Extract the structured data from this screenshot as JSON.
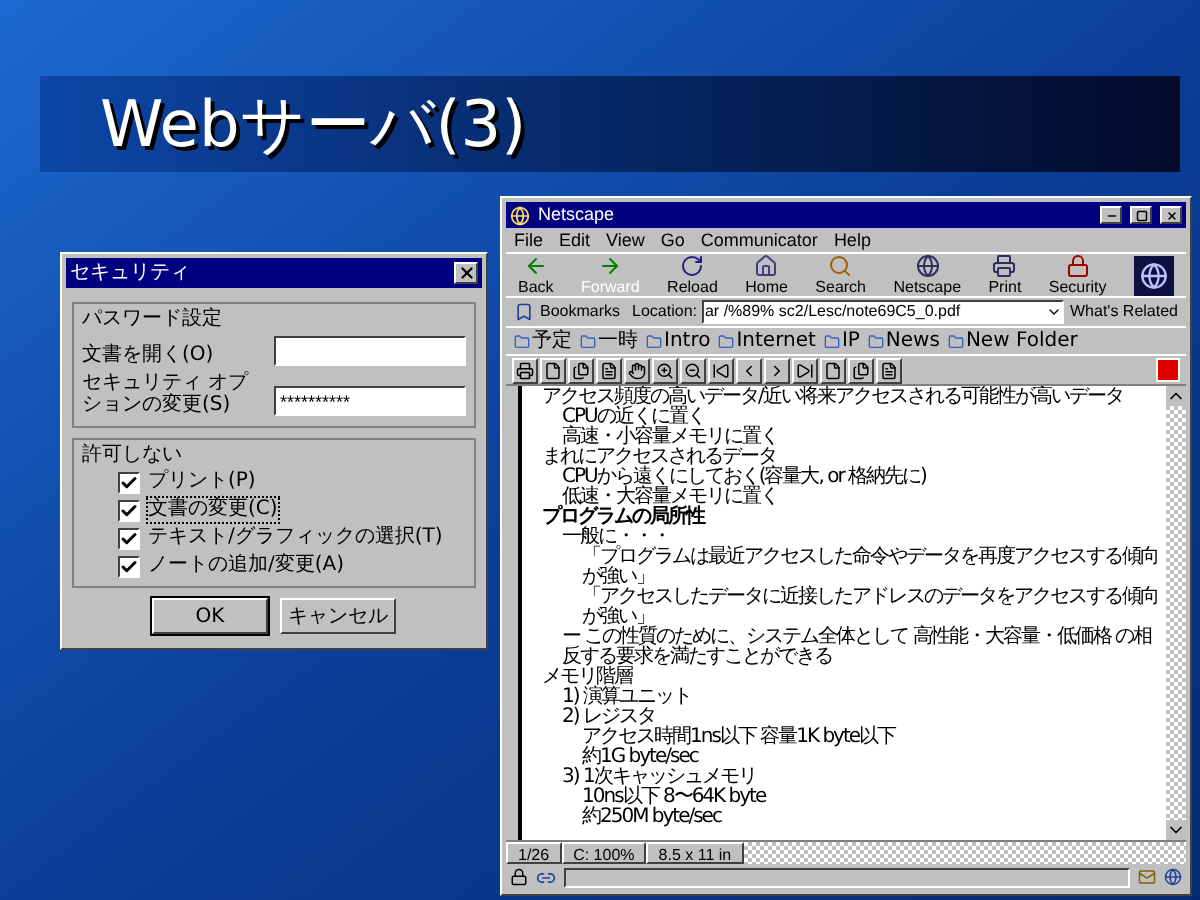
{
  "slide_title": "Webサーバ(3)",
  "dialog": {
    "title": "セキュリティ",
    "password_group": {
      "label": "パスワード設定",
      "fields": [
        {
          "label": "文書を開く(O)"
        },
        {
          "label": "セキュリティ オプションの変更(S)",
          "value": "**********"
        }
      ]
    },
    "permissions_group": {
      "label": "許可しない",
      "items": [
        {
          "label": "プリント(P)",
          "checked": true,
          "focused": false
        },
        {
          "label": "文書の変更(C)",
          "checked": true,
          "focused": true
        },
        {
          "label": "テキスト/グラフィックの選択(T)",
          "checked": true,
          "focused": false
        },
        {
          "label": "ノートの追加/変更(A)",
          "checked": true,
          "focused": false
        }
      ]
    },
    "buttons": [
      {
        "label": "OK",
        "default": true
      },
      {
        "label": "キャンセル",
        "default": false
      }
    ]
  },
  "browser": {
    "title": "Netscape",
    "menu": [
      "File",
      "Edit",
      "View",
      "Go",
      "Communicator",
      "Help"
    ],
    "toolbar": [
      {
        "label": "Back",
        "kind": "back",
        "disabled": false
      },
      {
        "label": "Forward",
        "kind": "forward",
        "disabled": true
      },
      {
        "label": "Reload",
        "kind": "reload",
        "disabled": false
      },
      {
        "label": "Home",
        "kind": "home",
        "disabled": false
      },
      {
        "label": "Search",
        "kind": "search",
        "disabled": false
      },
      {
        "label": "Netscape",
        "kind": "globe",
        "disabled": false
      },
      {
        "label": "Print",
        "kind": "print",
        "disabled": false
      },
      {
        "label": "Security",
        "kind": "lock",
        "disabled": false
      }
    ],
    "location": {
      "bookmarks": "Bookmarks",
      "label": "Location:",
      "url": "ar /%89% sc2/Lesc/note69C5_0.pdf",
      "related": "What's Related"
    },
    "personal": [
      "予定",
      "一時",
      "Intro",
      "Internet",
      "IP",
      "News",
      "New Folder"
    ],
    "document": [
      {
        "text": "アクセス頻度の高いデータ/近い将来アクセスされる可能性が高いデータ",
        "kind": "line",
        "children": [
          {
            "text": "CPUの近くに置く",
            "kind": "line"
          },
          {
            "text": "高速・小容量メモリに置く",
            "kind": "line"
          }
        ]
      },
      {
        "text": "まれにアクセスされるデータ",
        "kind": "line",
        "children": [
          {
            "text": "CPUから遠くにしておく(容量大, or 格納先に)",
            "kind": "line"
          },
          {
            "text": "低速・大容量メモリに置く",
            "kind": "line"
          }
        ]
      },
      {
        "text": "プログラムの局所性",
        "kind": "heading",
        "children": [
          {
            "text": "一般に・・・",
            "kind": "line",
            "children": [
              {
                "text": "「プログラムは最近アクセスした命令やデータを再度アクセスする傾向が強い」",
                "kind": "line"
              },
              {
                "text": "「アクセスしたデータに近接したアドレスのデータをアクセスする傾向が強い」",
                "kind": "line"
              }
            ]
          },
          {
            "text": "ー この性質のために、システム全体として 高性能・大容量・低価格 の相反する要求を満たすことができる",
            "kind": "line"
          }
        ]
      },
      {
        "text": "メモリ階層",
        "kind": "line",
        "children": [
          {
            "text": "1) 演算ユニット",
            "kind": "line"
          },
          {
            "text": "2) レジスタ",
            "kind": "line",
            "children": [
              {
                "text": "アクセス時間1ns以下 容量1K byte以下",
                "kind": "line"
              },
              {
                "text": "約1G byte/sec",
                "kind": "line"
              }
            ]
          },
          {
            "text": "3) 1次キャッシュメモリ",
            "kind": "line",
            "children": [
              {
                "text": "10ns以下 8〜64K byte",
                "kind": "line"
              },
              {
                "text": "約250M byte/sec",
                "kind": "line"
              }
            ]
          }
        ]
      }
    ],
    "tabs": [
      "1/26",
      "C: 100%",
      "8.5 x 11 in"
    ]
  }
}
